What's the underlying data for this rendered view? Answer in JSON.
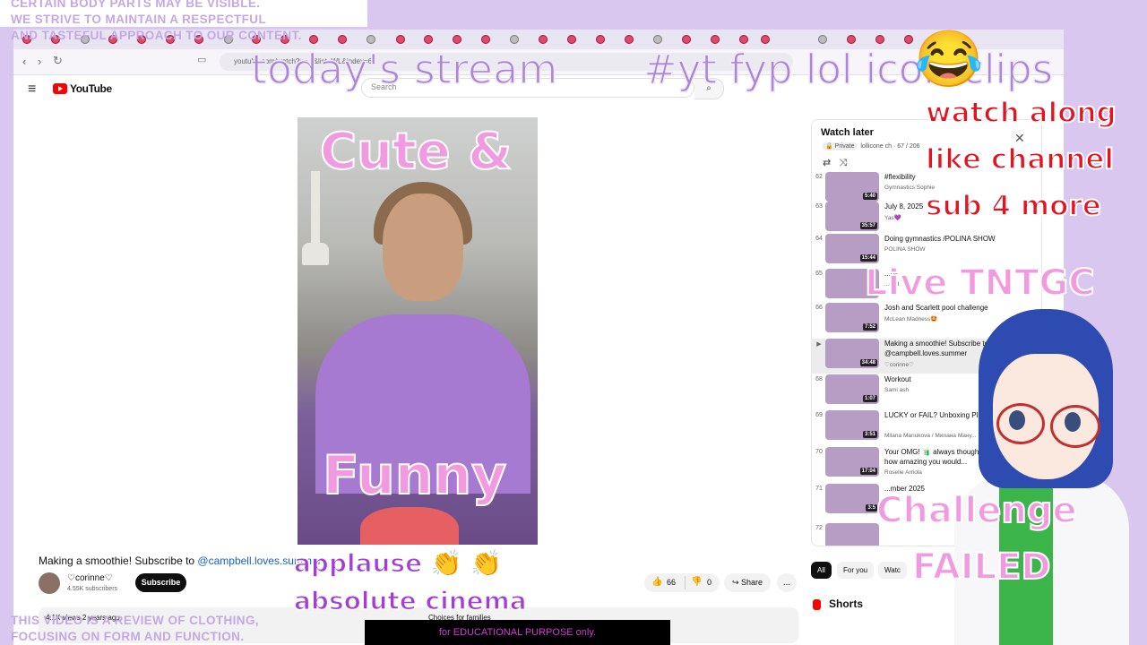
{
  "overlay": {
    "stream_title": "today's stream",
    "tags": "#yt fyp lol icon clips",
    "emoji": "😂",
    "callouts": [
      "watch along",
      "like channel",
      "sub 4 more"
    ],
    "live_tag": "Live TNTGC",
    "challenge": "Challenge",
    "failed": "FAILED",
    "video_top_caption": "Cute &",
    "video_bottom_caption": "Funny",
    "applause": "applause 👏 👏",
    "absolute_cinema": "absolute cinema",
    "disclaimer_top": [
      "CERTAIN BODY PARTS MAY BE VISIBLE.",
      "WE STRIVE TO MAINTAIN A RESPECTFUL",
      "AND TASTEFUL APPROACH TO OUR CONTENT."
    ],
    "disclaimer_bottom": [
      "THIS VIDEO IS A REVIEW OF CLOTHING,",
      "FOCUSING ON FORM AND FUNCTION."
    ],
    "edu_banner": "for EDUCATIONAL PURPOSE only."
  },
  "browser": {
    "url": "youtube.com/watch?v=...&list=WL&index=67"
  },
  "youtube": {
    "logo": "YouTube",
    "search_placeholder": "Search",
    "video": {
      "title": "Making a smoothie! Subscribe to ",
      "title_link": "@campbell.loves.summer",
      "channel": "♡corinne♡",
      "subscribers": "4.55K subscribers",
      "subscribe_label": "Subscribe",
      "likes": "66",
      "dislikes": "0",
      "share_label": "Share",
      "more_label": "...",
      "views_line": "4.1K views  2 years ago",
      "desc_snippet": "Choices for families"
    },
    "watch_later": {
      "title": "Watch later",
      "privacy": "Private",
      "owner": "lollicone ch",
      "position": "67 / 206",
      "items": [
        {
          "num": "62",
          "title": "#flexibility",
          "channel": "Gymnastics Sophie",
          "duration": "5:40"
        },
        {
          "num": "63",
          "title": "July 8, 2025",
          "channel": "Yas💜",
          "duration": "35:57"
        },
        {
          "num": "64",
          "title": "Doing gymnastics /POLINA SHOW",
          "channel": "POLINA SHOW",
          "duration": "15:44"
        },
        {
          "num": "65",
          "title": "...hil",
          "channel": "...orld",
          "duration": ""
        },
        {
          "num": "66",
          "title": "Josh and Scarlett pool challenge",
          "channel": "McLean Madness🤩",
          "duration": "7:52"
        },
        {
          "num": "▶",
          "title": "Making a smoothie! Subscribe to @campbell.loves.summer",
          "channel": "♡corinne♡",
          "duration": "34:48"
        },
        {
          "num": "68",
          "title": "Workout",
          "channel": "Sami ash",
          "duration": "1:07"
        },
        {
          "num": "69",
          "title": "LUCKY or FAIL? Unboxing Plush Blind Box",
          "channel": "Milana Manukova / Милана Ману...",
          "duration": "3:51"
        },
        {
          "num": "70",
          "title": "Your OMG! 🧃 always thought but never knew how amazing you would...",
          "channel": "Roselie Arriola",
          "duration": "17:04"
        },
        {
          "num": "71",
          "title": "...mber 2025",
          "channel": "",
          "duration": "3:5"
        },
        {
          "num": "72",
          "title": "",
          "channel": "",
          "duration": ""
        }
      ]
    },
    "chips": [
      "All",
      "For you",
      "Watc"
    ],
    "shorts_label": "Shorts"
  }
}
